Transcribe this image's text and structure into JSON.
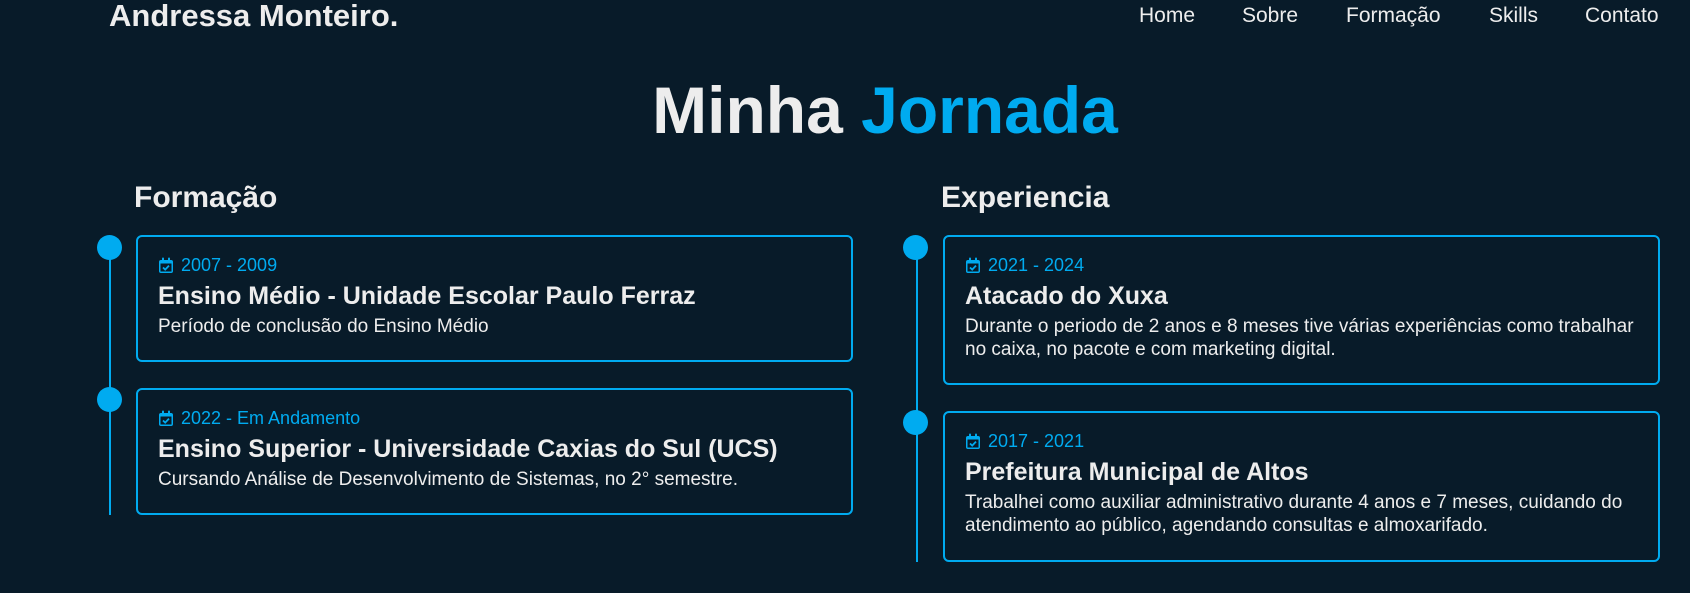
{
  "header": {
    "logo": "Andressa Monteiro.",
    "nav": [
      "Home",
      "Sobre",
      "Formação",
      "Skills",
      "Contato"
    ]
  },
  "section": {
    "title_part1": "Minha",
    "title_part2": "Jornada"
  },
  "education": {
    "heading": "Formação",
    "items": [
      {
        "year": "2007 - 2009",
        "title": "Ensino Médio - Unidade Escolar Paulo Ferraz",
        "description": "Período de conclusão do Ensino Médio"
      },
      {
        "year": "2022 - Em Andamento",
        "title": "Ensino Superior - Universidade Caxias do Sul (UCS)",
        "description": "Cursando Análise de Desenvolvimento de Sistemas, no 2° semestre."
      }
    ]
  },
  "experience": {
    "heading": "Experiencia",
    "items": [
      {
        "year": "2021 - 2024",
        "title": "Atacado do Xuxa",
        "description": "Durante o periodo de 2 anos e 8 meses tive várias experiências como trabalhar no caixa, no pacote e com marketing digital."
      },
      {
        "year": "2017 - 2021",
        "title": "Prefeitura Municipal de Altos",
        "description": "Trabalhei como auxiliar administrativo durante 4 anos e 7 meses, cuidando do atendimento ao público, agendando consultas e almoxarifado."
      }
    ]
  },
  "colors": {
    "background": "#081b29",
    "accent": "#00abf0",
    "text": "#ededed"
  },
  "icons": {
    "calendar": "calendar-check-icon"
  }
}
